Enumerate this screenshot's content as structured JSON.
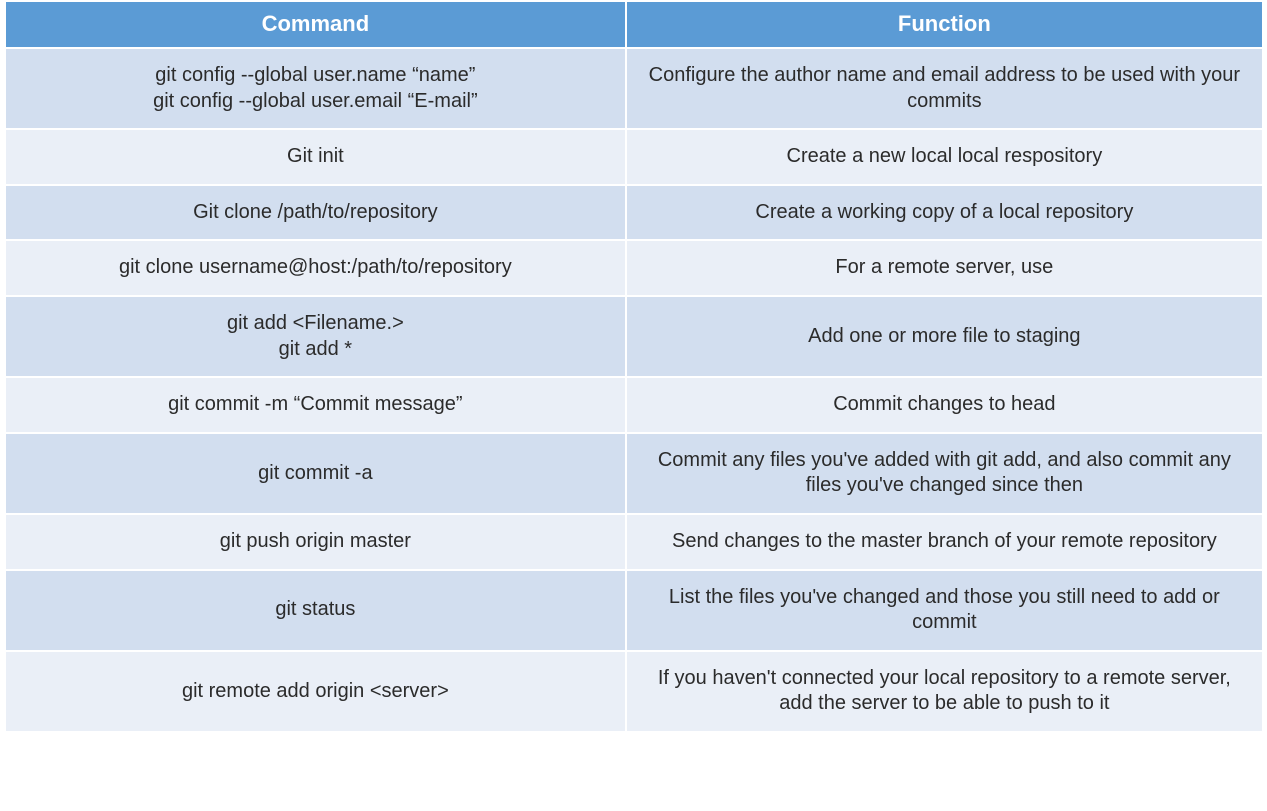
{
  "headers": {
    "command": "Command",
    "function": "Function"
  },
  "colors": {
    "header_bg": "#5b9bd5",
    "row_odd": "#d2deef",
    "row_even": "#eaeff7"
  },
  "chart_data": {
    "type": "table",
    "columns": [
      "Command",
      "Function"
    ],
    "rows": [
      [
        "git config --global user.name “name”\ngit config --global user.email “E-mail”",
        "Configure the author name and email address to be used with your commits"
      ],
      [
        "Git init",
        "Create a new local local respository"
      ],
      [
        "Git clone /path/to/repository",
        "Create a working copy of a local repository"
      ],
      [
        "git clone username@host:/path/to/repository",
        "For a remote server, use"
      ],
      [
        "git add <Filename.>\ngit add *",
        "Add one or more file to staging"
      ],
      [
        "git commit -m “Commit message”",
        "Commit changes to head"
      ],
      [
        "git commit -a",
        "Commit any files you've added with git add, and also commit any files you've changed since then"
      ],
      [
        "git push origin master",
        "Send changes to the master branch of your remote repository"
      ],
      [
        "git status",
        "List the files you've changed and those you still need to add or commit"
      ],
      [
        "git remote add origin <server>",
        "If you haven't connected your local repository to a remote server, add the server to be able to push to it"
      ]
    ]
  },
  "rows": [
    {
      "command": "git config --global user.name “name”\ngit config --global user.email “E-mail”",
      "function": "Configure the author name and email address to be used with your commits"
    },
    {
      "command": "Git init",
      "function": "Create a new local local respository"
    },
    {
      "command": "Git clone /path/to/repository",
      "function": "Create a working copy of a local repository"
    },
    {
      "command": "git clone username@host:/path/to/repository",
      "function": "For a remote server, use"
    },
    {
      "command": "git add <Filename.>\ngit add *",
      "function": "Add one or more file to staging"
    },
    {
      "command": "git commit -m “Commit message”",
      "function": "Commit changes to head"
    },
    {
      "command": "git commit -a",
      "function": "Commit any files you've added with git add, and also commit any files you've changed since then"
    },
    {
      "command": "git push origin master",
      "function": "Send changes to the master branch of your remote repository"
    },
    {
      "command": "git status",
      "function": "List the files you've changed and those you still need to add or commit"
    },
    {
      "command": "git remote add origin <server>",
      "function": "If you haven't connected your local repository to a remote server, add the server to be able to push to it"
    }
  ]
}
